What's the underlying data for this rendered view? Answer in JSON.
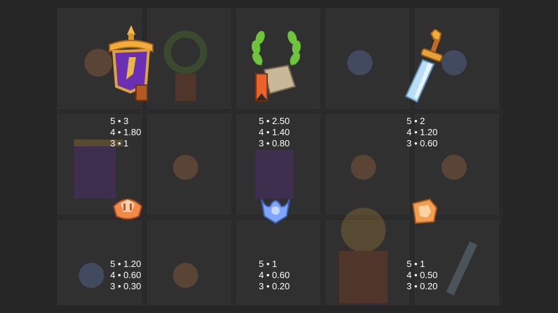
{
  "paytable": [
    {
      "symbol_icon": "purple-banner-icon",
      "lines": [
        "5 • 3",
        "4 • 1.80",
        "3 • 1"
      ]
    },
    {
      "symbol_icon": "laurel-wreath-icon",
      "lines": [
        "5 • 2.50",
        "4 • 1.40",
        "3 • 0.80"
      ]
    },
    {
      "symbol_icon": "sword-icon",
      "lines": [
        "5 • 2",
        "4 • 1.20",
        "3 • 0.60"
      ]
    },
    {
      "symbol_icon": "orange-emblem-icon",
      "lines": [
        "5 • 1.20",
        "4 • 0.60",
        "3 • 0.30"
      ]
    },
    {
      "symbol_icon": "blue-emblem-icon",
      "lines": [
        "5 • 1",
        "4 • 0.60",
        "3 • 0.20"
      ]
    },
    {
      "symbol_icon": "fist-emblem-icon",
      "lines": [
        "5 • 1",
        "4 • 0.50",
        "3 • 0.20"
      ]
    }
  ],
  "colors": {
    "background": "#262626",
    "panel": "#2b2b2b",
    "text": "#ffffff",
    "banner_purple": "#6b2fb3",
    "gold": "#e0a23a",
    "laurel_green": "#5fa52e",
    "blade_blue": "#a9d4f0",
    "emblem_orange": "#f08a4b",
    "emblem_blue": "#7fa6ff"
  }
}
